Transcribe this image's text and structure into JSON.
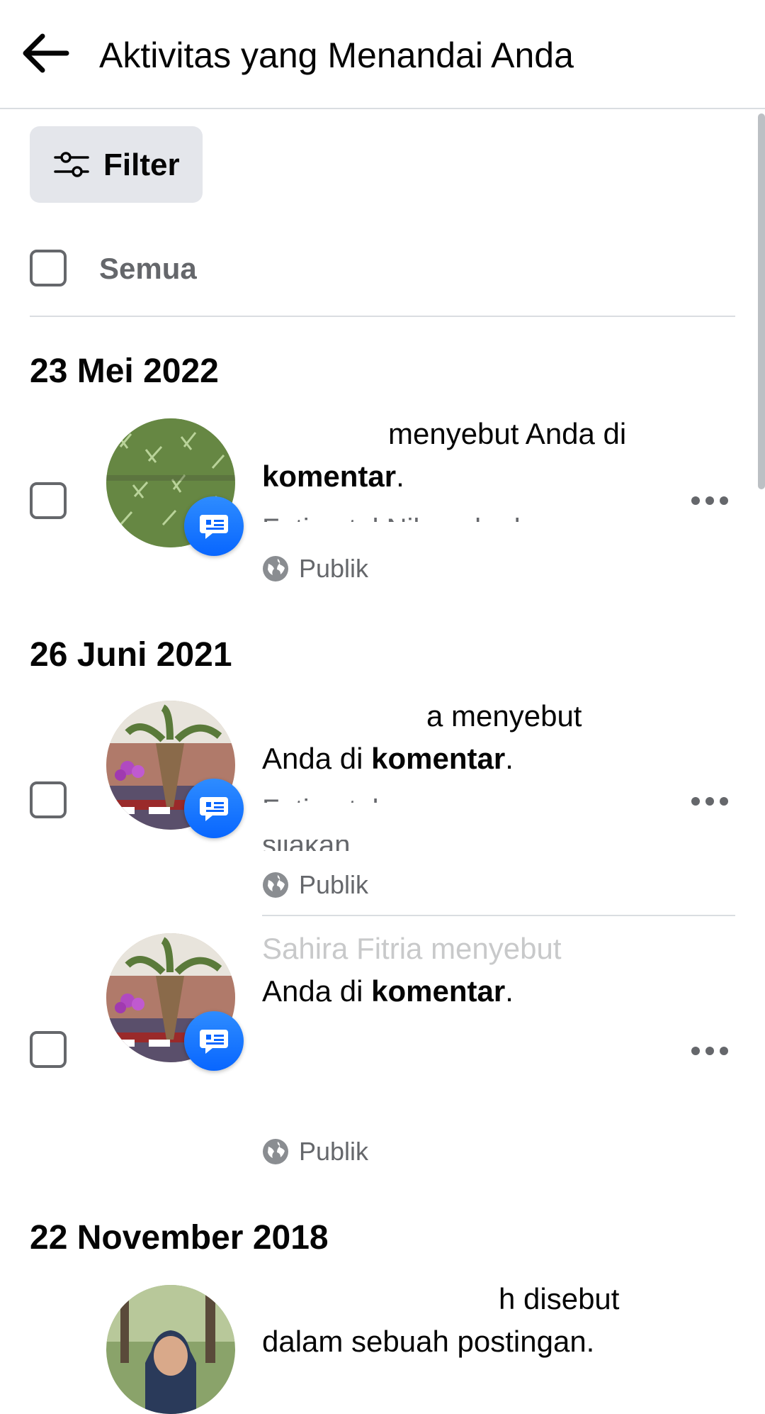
{
  "header": {
    "title": "Aktivitas yang Menandai Anda"
  },
  "toolbar": {
    "filter_label": "Filter",
    "select_all_label": "Semua"
  },
  "sections": [
    {
      "date": "23 Mei 2022"
    },
    {
      "date": "26 Juni 2021"
    },
    {
      "date": "22 November 2018"
    }
  ],
  "items": [
    {
      "text_before": "menyebut Anda di",
      "text_bold": "komentar",
      "text_after": ".",
      "secondary_line": "Fatimatul Nihayah akan",
      "privacy": "Publik"
    },
    {
      "text_before": "a menyebut",
      "text_line2_before": "Anda di ",
      "text_bold": "komentar",
      "text_after": ".",
      "secondary_line": "Fatimatul Nihayah",
      "secondary_line2": "silakan.",
      "privacy": "Publik"
    },
    {
      "text_before": "Sahira Fitria menyebut",
      "text_line2_before": "Anda di ",
      "text_bold": "komentar",
      "text_after": ".",
      "privacy": "Publik"
    },
    {
      "text_line1": "h disebut",
      "text_line2": "dalam sebuah postingan."
    }
  ],
  "colors": {
    "accent": "#0866ff",
    "secondary_text": "#65676b",
    "divider": "#dadde1"
  }
}
